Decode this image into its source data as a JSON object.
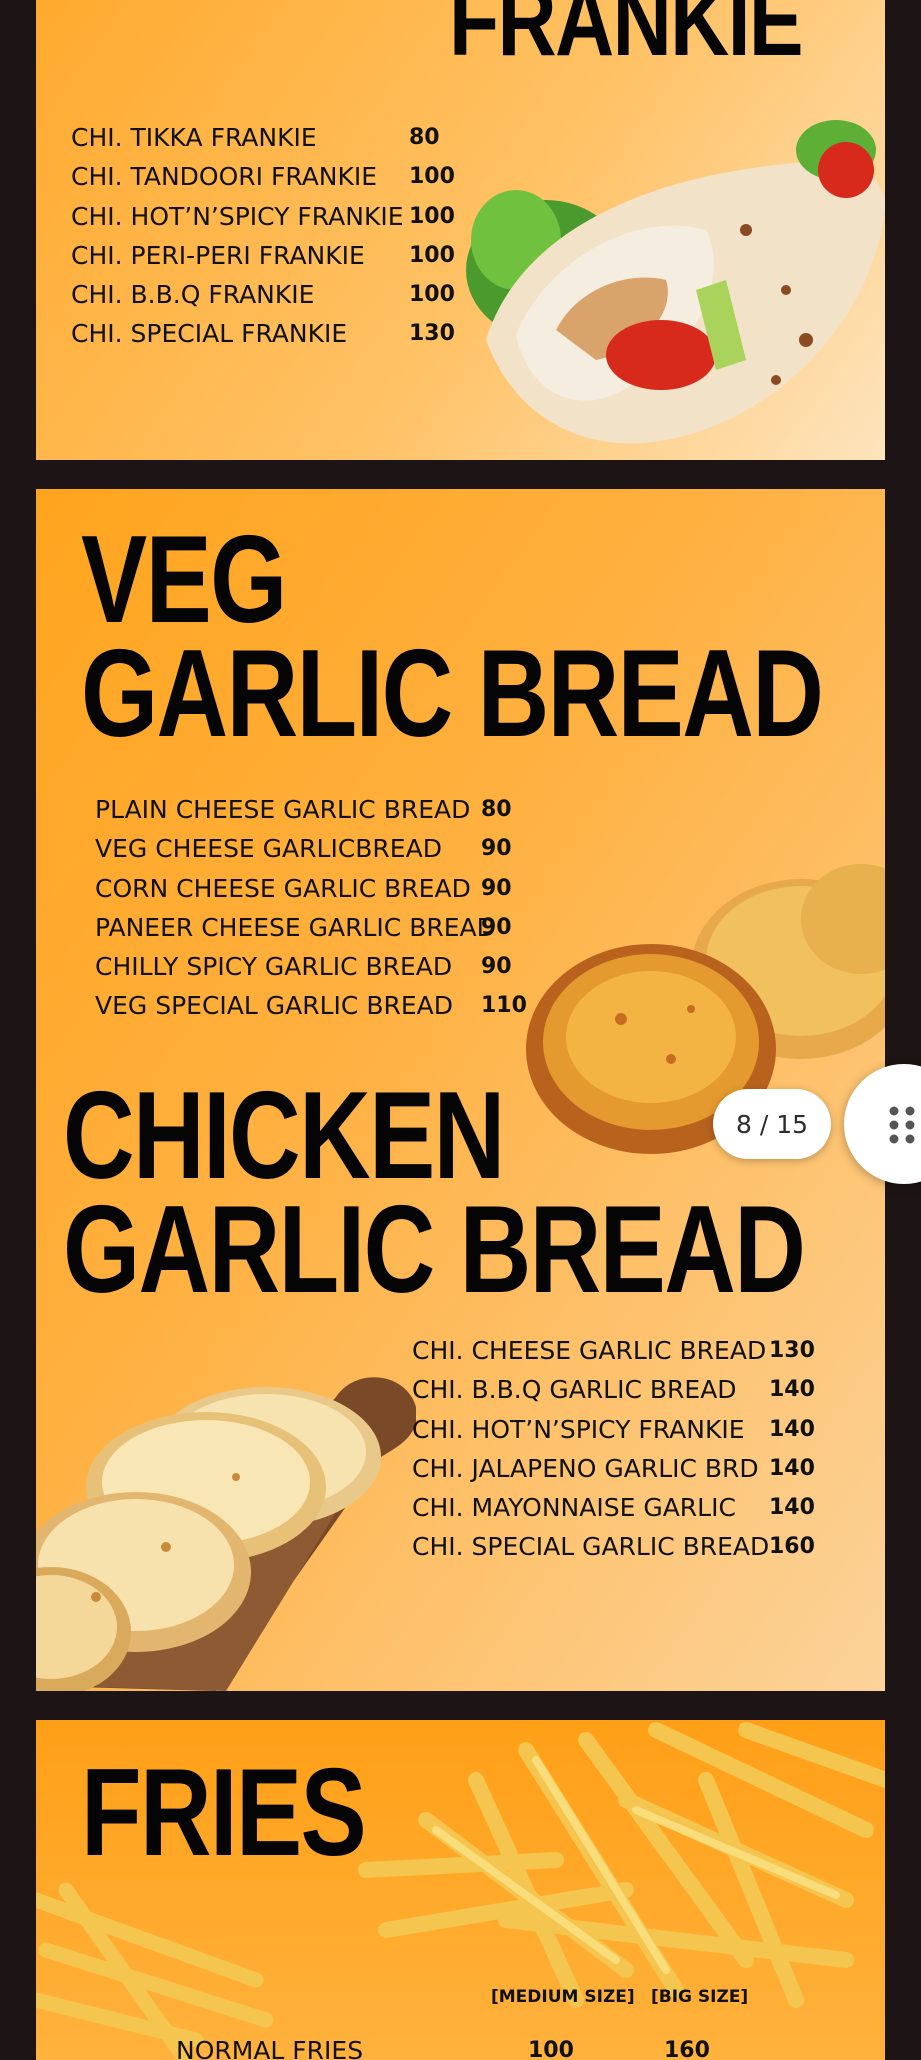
{
  "frankie": {
    "title": "FRANKIE",
    "items": [
      {
        "name": "CHI. TIKKA FRANKIE",
        "price": "80"
      },
      {
        "name": "CHI. TANDOORI FRANKIE",
        "price": "100"
      },
      {
        "name": "CHI. HOT’N’SPICY FRANKIE",
        "price": "100"
      },
      {
        "name": "CHI. PERI-PERI FRANKIE",
        "price": "100"
      },
      {
        "name": "CHI. B.B.Q FRANKIE",
        "price": "100"
      },
      {
        "name": "CHI. SPECIAL FRANKIE",
        "price": "130"
      }
    ]
  },
  "veg_garlic_bread": {
    "title_line1": "VEG",
    "title_line2": "GARLIC BREAD",
    "items": [
      {
        "name": "PLAIN CHEESE GARLIC BREAD",
        "price": "80"
      },
      {
        "name": "VEG CHEESE GARLICBREAD",
        "price": "90"
      },
      {
        "name": "CORN CHEESE GARLIC BREAD",
        "price": "90"
      },
      {
        "name": "PANEER CHEESE GARLIC BREAD",
        "price": "90"
      },
      {
        "name": "CHILLY SPICY GARLIC BREAD",
        "price": "90"
      },
      {
        "name": "VEG SPECIAL GARLIC BREAD",
        "price": "110"
      }
    ]
  },
  "chicken_garlic_bread": {
    "title_line1": "CHICKEN",
    "title_line2": "GARLIC BREAD",
    "items": [
      {
        "name": "CHI. CHEESE GARLIC BREAD",
        "price": "130"
      },
      {
        "name": "CHI. B.B.Q GARLIC BREAD",
        "price": "140"
      },
      {
        "name": "CHI. HOT’N’SPICY FRANKIE",
        "price": "140"
      },
      {
        "name": "CHI. JALAPENO GARLIC BRD",
        "price": "140"
      },
      {
        "name": "CHI. MAYONNAISE GARLIC",
        "price": "140"
      },
      {
        "name": "CHI. SPECIAL GARLIC BREAD",
        "price": "160"
      }
    ]
  },
  "fries": {
    "title": "FRIES",
    "size_medium": "[MEDIUM SIZE]",
    "size_big": "[BIG SIZE]",
    "first_item": {
      "name": "NORMAL FRIES",
      "price_medium": "100",
      "price_big": "160"
    }
  },
  "viewer": {
    "page_counter": "8 / 15",
    "drag_handle_icon": "grip-dots-icon"
  },
  "colors": {
    "background": "#1c1415",
    "panel_orange": "#ffa41e",
    "heading_text": "#050505"
  }
}
